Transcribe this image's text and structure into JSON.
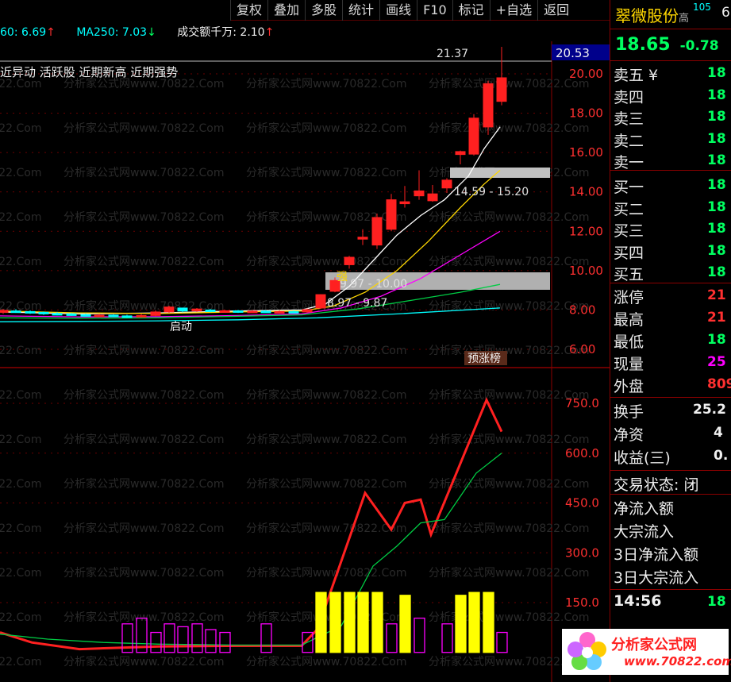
{
  "toolbar": {
    "buttons": [
      "复权",
      "叠加",
      "多股",
      "统计",
      "画线",
      "F10",
      "标记",
      "+自选",
      "返回"
    ]
  },
  "indicators": {
    "ma60": "60: 6.69",
    "ma60_arrow": "↑",
    "ma250": "MA250: 7.03",
    "ma250_arrow": "↓",
    "volume": "成交额千万: 2.10",
    "volume_arrow": "↑"
  },
  "tags": "近异动 活跃股 近期新高 近期强势",
  "chart_labels": {
    "high_label": "21.37",
    "price_marker": "20.53",
    "zone_upper": "14.59 - 15.20",
    "zone_lower_a": "9.97 - 10.00",
    "zone_lower_b": "8.97 - 9.87",
    "strong_label": "强",
    "start_label": "启动",
    "rank_label": "预涨榜"
  },
  "price_axis": [
    "20.00",
    "18.00",
    "16.00",
    "14.00",
    "12.00",
    "10.00",
    "8.00",
    "6.00"
  ],
  "volume_axis": [
    "750.0",
    "600.0",
    "450.0",
    "300.0",
    "150.0"
  ],
  "watermark": "分析家公式网www.70822.Com",
  "panel": {
    "name": "翠微股份",
    "name_suffix": "高",
    "badge": "105",
    "extra": "6",
    "price": "18.65",
    "change": "-0.78",
    "order_book": [
      {
        "label": "卖五",
        "suffix": "¥",
        "value": "18"
      },
      {
        "label": "卖四",
        "suffix": "",
        "value": "18"
      },
      {
        "label": "卖三",
        "suffix": "",
        "value": "18"
      },
      {
        "label": "卖二",
        "suffix": "",
        "value": "18"
      },
      {
        "label": "卖一",
        "suffix": "",
        "value": "18"
      },
      {
        "label": "买一",
        "suffix": "",
        "value": "18"
      },
      {
        "label": "买二",
        "suffix": "",
        "value": "18"
      },
      {
        "label": "买三",
        "suffix": "",
        "value": "18"
      },
      {
        "label": "买四",
        "suffix": "",
        "value": "18"
      },
      {
        "label": "买五",
        "suffix": "",
        "value": "18"
      }
    ],
    "stats": [
      {
        "label": "涨停",
        "value": "21"
      },
      {
        "label": "最高",
        "value": "21"
      },
      {
        "label": "最低",
        "value": "18"
      },
      {
        "label": "现量",
        "value": "25"
      },
      {
        "label": "外盘",
        "value": "809"
      }
    ],
    "stats2": [
      {
        "label": "换手",
        "value": "25.2"
      },
      {
        "label": "净资",
        "value": "4"
      },
      {
        "label": "收益(三)",
        "value": "0."
      }
    ],
    "trade_status": "交易状态: 闭",
    "flows": [
      "净流入额",
      "大宗流入",
      "3日净流入额",
      "3日大宗流入"
    ],
    "time": "14:56",
    "time_value": "18"
  },
  "logo": {
    "text": "分析家公式网",
    "url": "www.70822.com"
  },
  "colors": {
    "up": "#ff2020",
    "down": "#00ffff",
    "grid": "#8b0000",
    "ma5": "#ffffff",
    "ma10": "#ffd700",
    "ma20": "#ff00ff",
    "ma60": "#00cc44"
  }
}
